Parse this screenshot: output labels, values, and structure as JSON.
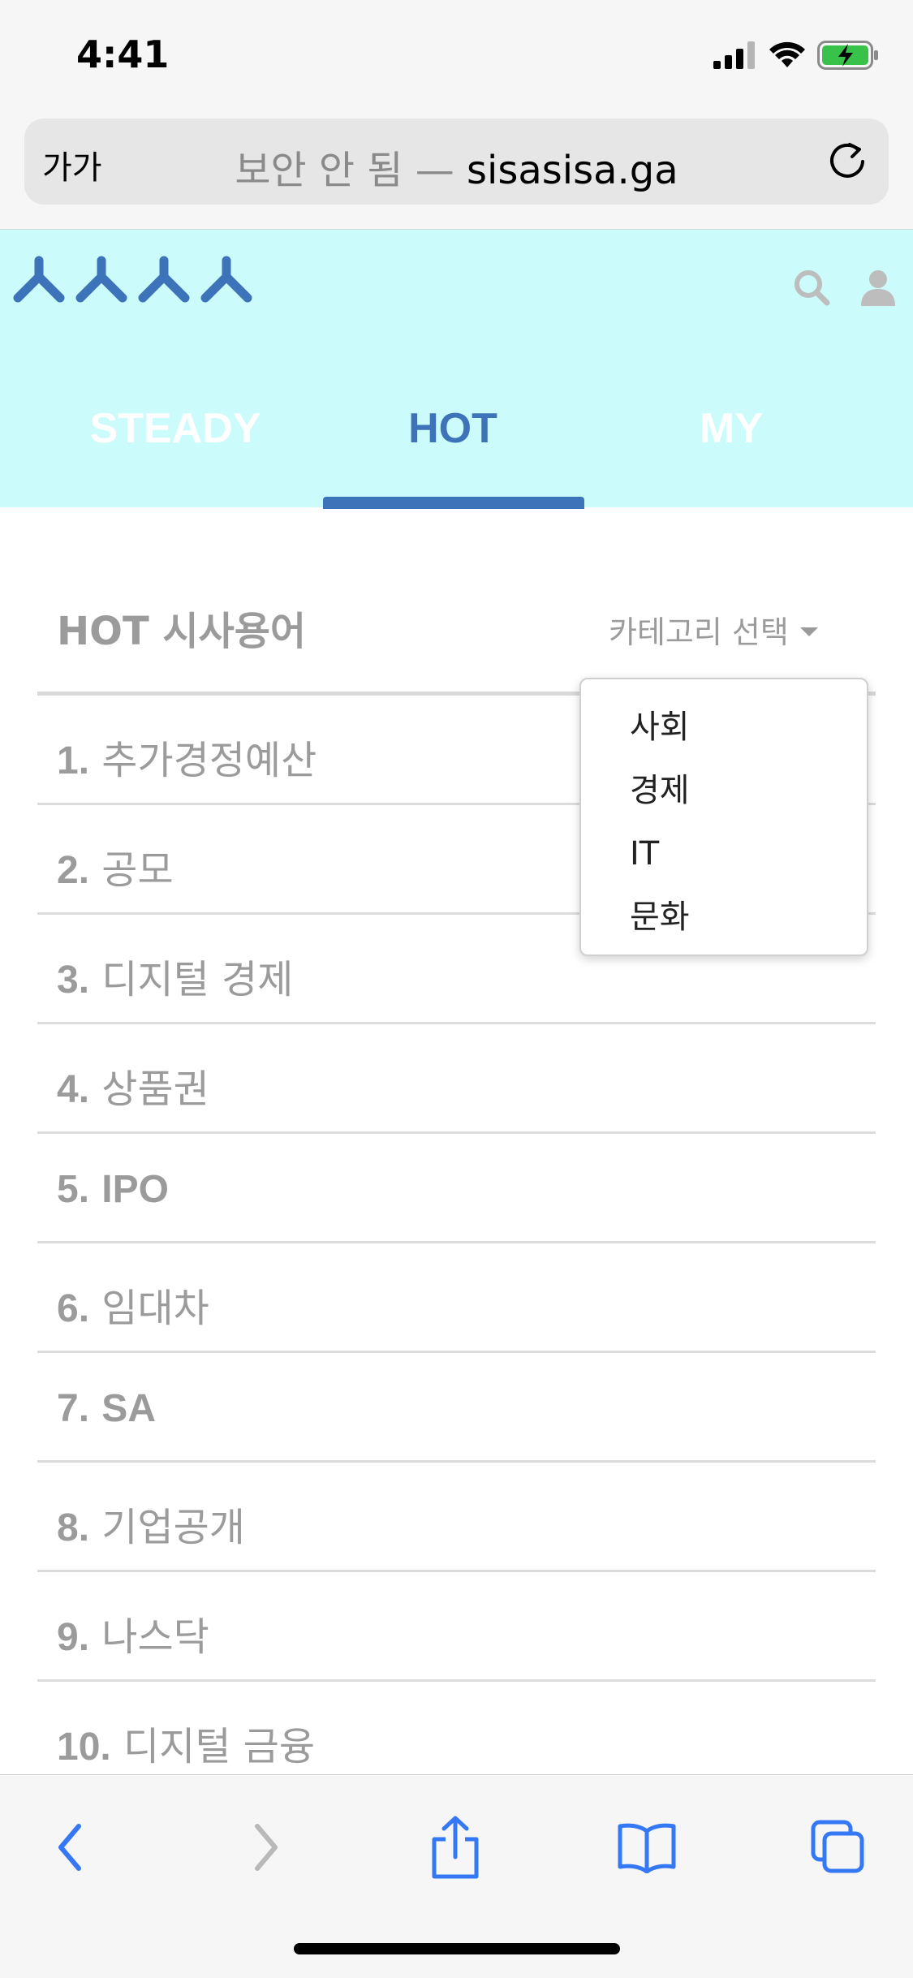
{
  "status": {
    "time": "4:41"
  },
  "browser": {
    "text_size_label": "가가",
    "insecure_label": "보안 안 됨 —",
    "domain": "sisasisa.ga"
  },
  "site": {
    "logo": "ㅅㅅㅅㅅ",
    "tabs": [
      {
        "label": "STEADY",
        "active": false
      },
      {
        "label": "HOT",
        "active": true
      },
      {
        "label": "MY",
        "active": false
      }
    ]
  },
  "main": {
    "section_title": "HOT 시사용어",
    "category_select": "카테고리 선택",
    "category_options": [
      "사회",
      "경제",
      "IT",
      "문화"
    ],
    "terms": [
      {
        "num": "1.",
        "term": "추가경정예산"
      },
      {
        "num": "2.",
        "term": "공모"
      },
      {
        "num": "3.",
        "term": "디지털 경제"
      },
      {
        "num": "4.",
        "term": "상품권"
      },
      {
        "num": "5.",
        "term": "IPO"
      },
      {
        "num": "6.",
        "term": "임대차"
      },
      {
        "num": "7.",
        "term": "SA"
      },
      {
        "num": "8.",
        "term": "기업공개"
      },
      {
        "num": "9.",
        "term": "나스닥"
      },
      {
        "num": "10.",
        "term": "디지털 금융"
      }
    ]
  },
  "colors": {
    "header_bg": "#cbfbfb",
    "accent": "#3d74b9",
    "ios_blue": "#3478f6",
    "muted_text": "#9b9b9b"
  },
  "icons": [
    "signal-icon",
    "wifi-icon",
    "battery-charging-icon",
    "reload-icon",
    "search-icon",
    "user-icon",
    "back-icon",
    "forward-icon",
    "share-icon",
    "bookmarks-icon",
    "tabs-icon"
  ]
}
